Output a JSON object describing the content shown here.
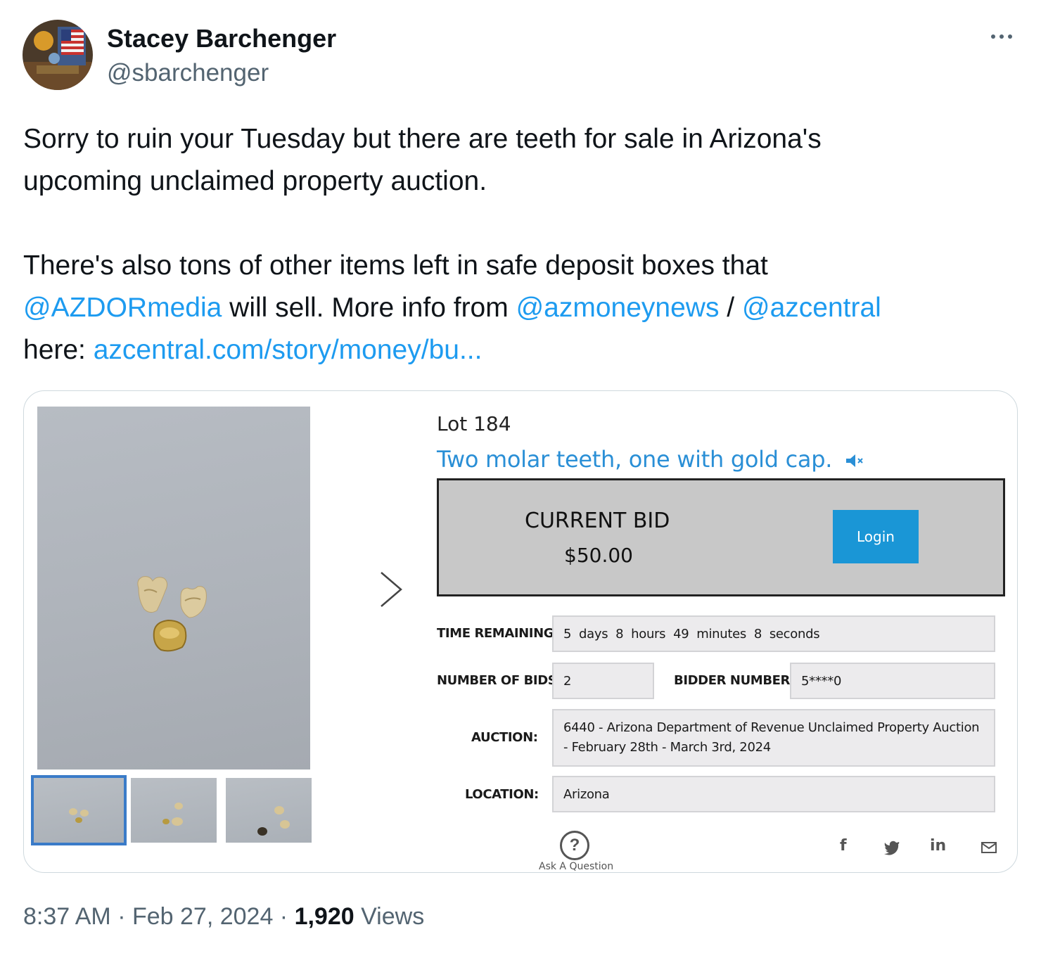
{
  "author": {
    "name": "Stacey Barchenger",
    "handle": "@sbarchenger"
  },
  "tweet": {
    "line1": "Sorry to ruin your Tuesday but there are teeth for sale in Arizona's",
    "line2": "upcoming unclaimed property auction.",
    "line3": "There's also tons of other items left in safe deposit boxes that",
    "mention1": "@AZDORmedia",
    "text_after_mention1": " will sell. More info from ",
    "mention2": "@azmoneynews",
    "separator": " / ",
    "mention3": "@azcentral",
    "text_here": "here: ",
    "link": "azcentral.com/story/money/bu..."
  },
  "auction": {
    "lot_title": "Lot 184",
    "description": "Two molar teeth, one with gold cap.",
    "current_bid_label": "CURRENT BID",
    "current_bid_amount": "$50.00",
    "login_label": "Login",
    "time_remaining_label": "TIME REMAINING:",
    "time_remaining_value": "5  days  8  hours  49  minutes  8  seconds",
    "number_of_bids_label": "NUMBER OF BIDS:",
    "number_of_bids_value": "2",
    "bidder_number_label": "BIDDER NUMBER:",
    "bidder_number_value": "5****0",
    "auction_label": "AUCTION:",
    "auction_value": "6440 - Arizona Department of Revenue Unclaimed Property Auction - February 28th - March 3rd, 2024",
    "location_label": "LOCATION:",
    "location_value": "Arizona",
    "ask_question_label": "Ask A Question",
    "share_icons": [
      "facebook-icon",
      "twitter-icon",
      "linkedin-icon",
      "email-icon"
    ]
  },
  "meta": {
    "time": "8:37 AM",
    "dot1": " · ",
    "date": "Feb 27, 2024",
    "dot2": " · ",
    "views_count": "1,920",
    "views_label": " Views"
  },
  "colors": {
    "link": "#1d9bf0",
    "auction_link": "#2a8fd6",
    "login_button": "#1a96d6",
    "muted": "#536471"
  }
}
